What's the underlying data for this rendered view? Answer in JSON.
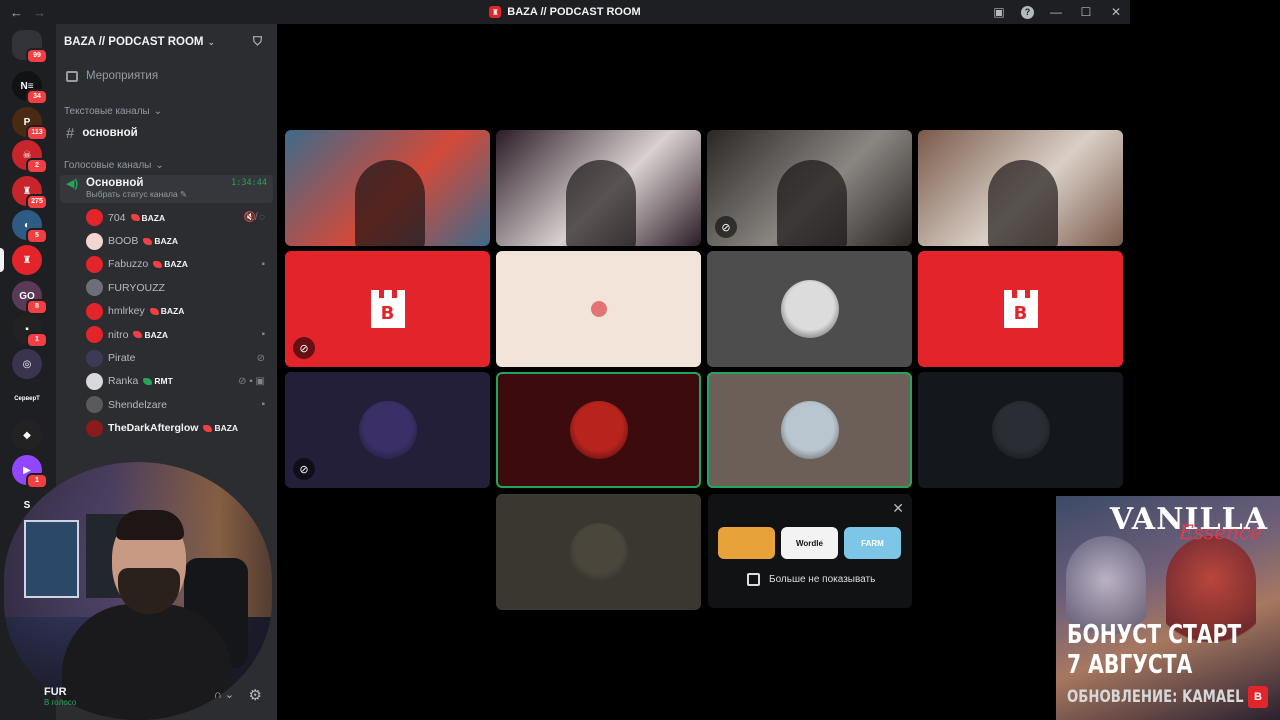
{
  "window": {
    "title": "BAZA // PODCAST ROOM",
    "nav_back": "←",
    "nav_forward": "→",
    "controls": {
      "inbox": "▣",
      "help": "?",
      "minimize": "—",
      "maximize": "☐",
      "close": "✕"
    }
  },
  "servers": [
    {
      "label": "",
      "badge": "99",
      "color": "#313338",
      "icon": "discord-home-icon"
    },
    {
      "label": "N≡",
      "badge": "34",
      "color": "#111214"
    },
    {
      "label": "P",
      "badge": "113",
      "color": "#4a2a12"
    },
    {
      "label": "☠",
      "badge": "2",
      "color": "#c8242c"
    },
    {
      "label": "♜",
      "badge": "275",
      "color": "#c8242c"
    },
    {
      "label": "◐",
      "badge": "5",
      "color": "#2e5a86"
    },
    {
      "label": "♜",
      "badge": "",
      "color": "#e3242b",
      "active": true
    },
    {
      "label": "GO",
      "badge": "8",
      "color": "#5b3a58"
    },
    {
      "label": "▪",
      "badge": "1",
      "color": "#222"
    },
    {
      "label": "◎",
      "badge": "",
      "color": "#3b3450"
    },
    {
      "label": "СерверТ",
      "badge": "",
      "color": "#1e1f22"
    },
    {
      "label": "◆",
      "badge": "",
      "color": "#222"
    },
    {
      "label": "▶",
      "badge": "1",
      "color": "#9146ff"
    },
    {
      "label": "S",
      "badge": "",
      "color": "#1e1f22"
    }
  ],
  "sidebar": {
    "guild_name": "BAZA // PODCAST ROOM",
    "events_label": "Мероприятия",
    "text_category": "Текстовые каналы",
    "text_channel": "основной",
    "voice_category": "Голосовые каналы",
    "voice_channel": "Основной",
    "voice_time": "1:34:44",
    "voice_status": "Выбрать статус канала ✎",
    "users": [
      {
        "name": "704",
        "tag": "BAZA",
        "tag_color": "#f23f43",
        "av_color": "#e3242b",
        "icons": "🔇̸ ◌"
      },
      {
        "name": "BOOB",
        "tag": "BAZA",
        "tag_color": "#f23f43",
        "av_color": "#f3d6cf",
        "icons": ""
      },
      {
        "name": "Fabuzzo",
        "tag": "BAZA",
        "tag_color": "#f23f43",
        "av_color": "#e3242b",
        "icons": "▪"
      },
      {
        "name": "FURYOUZZ",
        "tag": "",
        "tag_color": "",
        "av_color": "#6d6f78",
        "icons": ""
      },
      {
        "name": "hmlrkey",
        "tag": "BAZA",
        "tag_color": "#f23f43",
        "av_color": "#e3242b",
        "icons": ""
      },
      {
        "name": "nitro",
        "tag": "BAZA",
        "tag_color": "#f23f43",
        "av_color": "#e3242b",
        "icons": "▪"
      },
      {
        "name": "Pirate",
        "tag": "",
        "tag_color": "",
        "av_color": "#3b3b58",
        "icons": "⊘"
      },
      {
        "name": "Ranka",
        "tag": "RMT",
        "tag_color": "#23a55a",
        "av_color": "#d9d9d9",
        "icons": "⊘ ▪ ▣"
      },
      {
        "name": "Shendelzare",
        "tag": "",
        "tag_color": "",
        "av_color": "#5a5a5a",
        "icons": "▪"
      },
      {
        "name": "TheDarkAfterglow",
        "tag": "BAZA",
        "tag_color": "#f23f43",
        "av_color": "#8b1a1a",
        "icons": ""
      }
    ]
  },
  "user_panel": {
    "name": "FUR",
    "status": "В голосо",
    "gear": "⚙",
    "headset": "∩ ⌄"
  },
  "tiles": [
    {
      "type": "video",
      "bg": "#3d6b8a",
      "accent": "#d24a3a",
      "speaking": false,
      "mute": ""
    },
    {
      "type": "video",
      "bg": "#2a1c26",
      "accent": "#d9d0d0",
      "speaking": false,
      "mute": ""
    },
    {
      "type": "video",
      "bg": "#2a2724",
      "accent": "#8a8682",
      "speaking": false,
      "mute": "⊘"
    },
    {
      "type": "video",
      "bg": "#7a5a4a",
      "accent": "#d9cfc6",
      "speaking": false,
      "mute": ""
    },
    {
      "type": "logo",
      "bg": "#e3242b",
      "logo": "B",
      "speaking": false,
      "mute": "⊘"
    },
    {
      "type": "avatar",
      "bg": "#f3e4da",
      "av_color": "#e57373",
      "av_size": "small",
      "speaking": false,
      "mute": ""
    },
    {
      "type": "avatar",
      "bg": "#4d4d4d",
      "av_color": "#dcdcdc",
      "speaking": false,
      "mute": ""
    },
    {
      "type": "logo",
      "bg": "#e3242b",
      "logo": "B",
      "speaking": false,
      "mute": ""
    },
    {
      "type": "avatar",
      "bg": "#231f38",
      "av_color": "#3b2f68",
      "speaking": false,
      "mute": "⊘"
    },
    {
      "type": "avatar",
      "bg": "#3b0b0e",
      "av_color": "#b8231d",
      "speaking": true,
      "mute": ""
    },
    {
      "type": "avatar",
      "bg": "#6b5f57",
      "av_color": "#b9c6cf",
      "speaking": true,
      "mute": ""
    },
    {
      "type": "avatar",
      "bg": "#14171c",
      "av_color": "#2a2d33",
      "speaking": false,
      "mute": ""
    },
    {
      "type": "avatar",
      "bg": "#3a3730",
      "av_color": "#4a463c",
      "speaking": false,
      "mute": ""
    }
  ],
  "promo": {
    "close": "✕",
    "games": [
      {
        "label": "",
        "bg": "#e8a23a",
        "color": "#c2342b"
      },
      {
        "label": "Wordle",
        "bg": "#f3f3f3",
        "color": "#111"
      },
      {
        "label": "FARM",
        "bg": "#7dc6e8",
        "color": "#fff"
      }
    ],
    "dont_show": "Больше не показывать"
  },
  "ad": {
    "title_top": "VANILLA",
    "title_script": "Essence",
    "line1": "БОНУСТ СТАРТ",
    "line2": "7 АВГУСТА",
    "line3": "ОБНОВЛЕНИЕ: KAMAEL",
    "logo": "B"
  }
}
